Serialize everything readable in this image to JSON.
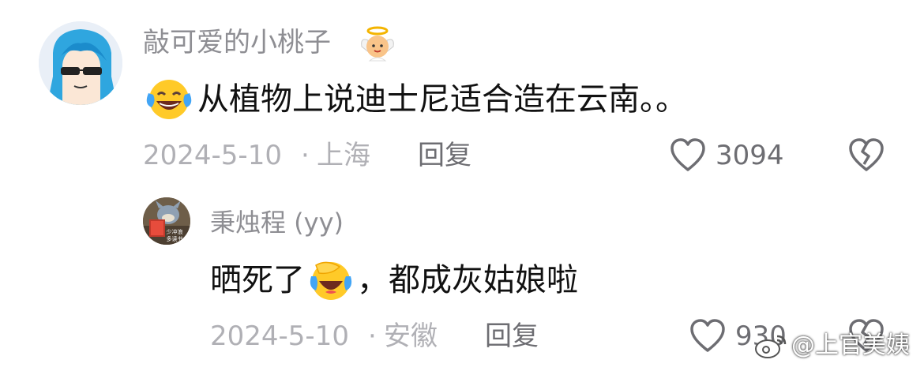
{
  "comment1": {
    "username": "敲可爱的小桃子",
    "badge_icon": "angel-baby-emoji",
    "text": "从植物上说迪士尼适合造在云南。。",
    "leading_icon": "laughing-tears-emoji",
    "date": "2024-5-10",
    "location": "上海",
    "reply_label": "回复",
    "like_count": "3094"
  },
  "comment2": {
    "username": "秉烛程 (yy)",
    "text_before": "晒死了",
    "inline_icon": "tearful-laughing-emoji",
    "text_after": "，都成灰姑娘啦",
    "date": "2024-5-10",
    "location": "安徽",
    "reply_label": "回复",
    "like_count": "930",
    "avatar_text": "少冲浪\n多读书"
  },
  "watermark": {
    "text": "@上官美姨"
  },
  "colors": {
    "meta": "#b0b0b5",
    "username": "#8e8e93",
    "action": "#6d6d72"
  }
}
